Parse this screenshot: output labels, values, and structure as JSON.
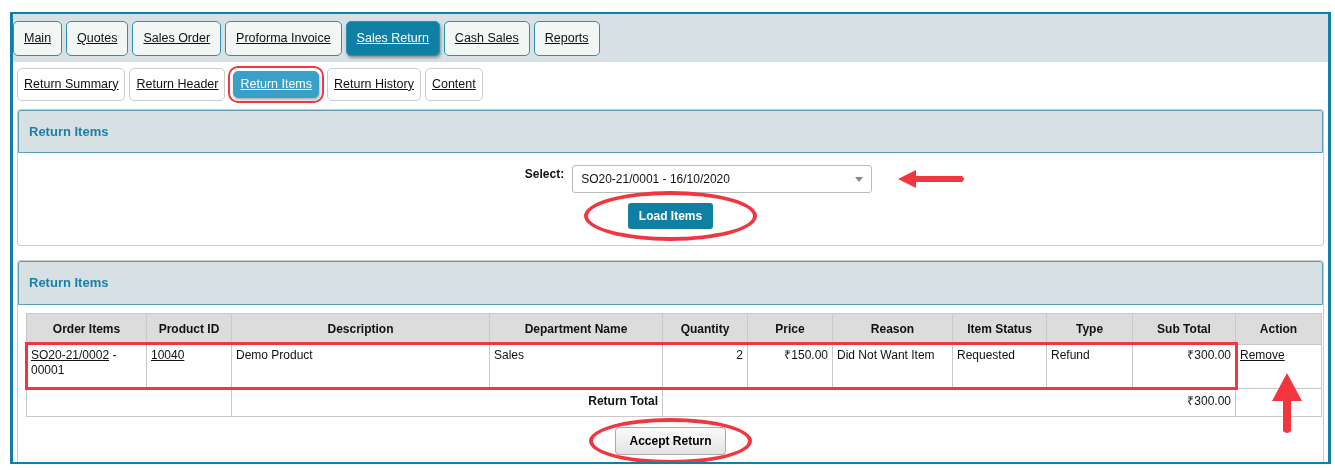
{
  "main_tabs": [
    {
      "label": "Main",
      "selected": false
    },
    {
      "label": "Quotes",
      "selected": false
    },
    {
      "label": "Sales Order",
      "selected": false
    },
    {
      "label": "Proforma Invoice",
      "selected": false
    },
    {
      "label": "Sales Return",
      "selected": true
    },
    {
      "label": "Cash Sales",
      "selected": false
    },
    {
      "label": "Reports",
      "selected": false
    }
  ],
  "sub_tabs": [
    {
      "label": "Return Summary",
      "selected": false,
      "highlighted": false
    },
    {
      "label": "Return Header",
      "selected": false,
      "highlighted": false
    },
    {
      "label": "Return Items",
      "selected": true,
      "highlighted": true
    },
    {
      "label": "Return History",
      "selected": false,
      "highlighted": false
    },
    {
      "label": "Content",
      "selected": false,
      "highlighted": false
    }
  ],
  "select_panel": {
    "title": "Return Items",
    "select_label": "Select:",
    "select_value": "SO20-21/0001 - 16/10/2020",
    "arrow_pointer": true,
    "button": {
      "label": "Load Items",
      "circled": true
    }
  },
  "items_panel": {
    "title": "Return Items",
    "columns": [
      "Order Items",
      "Product ID",
      "Description",
      "Department Name",
      "Quantity",
      "Price",
      "Reason",
      "Item Status",
      "Type",
      "Sub Total",
      "Action"
    ],
    "rows": [
      {
        "order_item_link": "SO20-21/0002",
        "order_item_suffix": " - 00001",
        "product_id": "10040",
        "description": "Demo Product",
        "department": "Sales",
        "quantity": "2",
        "price": "₹150.00",
        "reason": "Did Not Want Item",
        "item_status": "Requested",
        "type": "Refund",
        "sub_total": "₹300.00",
        "action": "Remove",
        "highlighted": true,
        "action_arrow": true
      }
    ],
    "total_label": "Return Total",
    "total_value": "₹300.00",
    "button": {
      "label": "Accept Return",
      "circled": true
    }
  }
}
